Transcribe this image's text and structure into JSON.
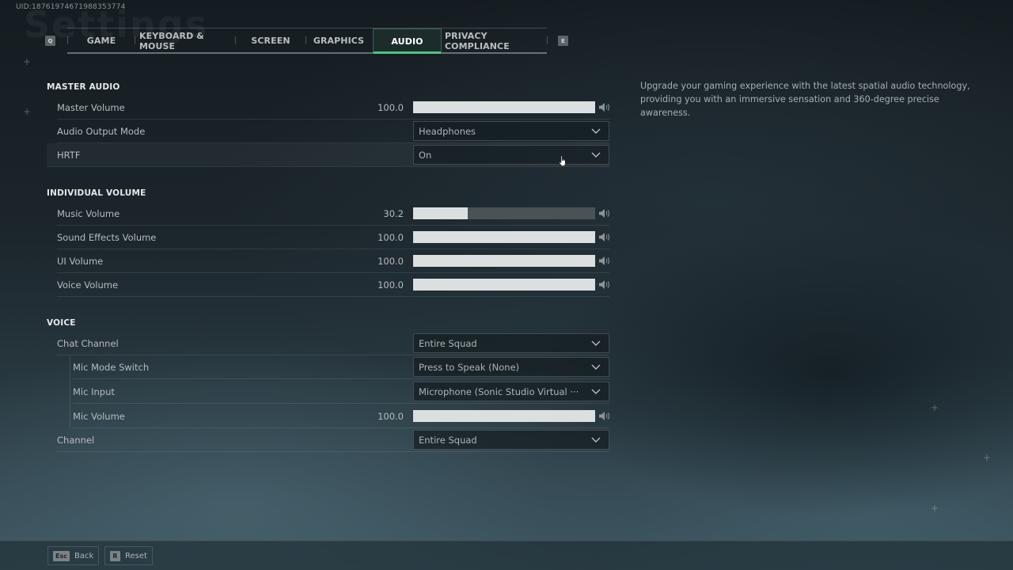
{
  "page": {
    "uid": "UID:18761974671988353774",
    "background_title": "Settings"
  },
  "tabs": {
    "prev_key": "Q",
    "next_key": "E",
    "items": [
      {
        "label": "GAME",
        "active": false
      },
      {
        "label": "KEYBOARD & MOUSE",
        "active": false
      },
      {
        "label": "SCREEN",
        "active": false
      },
      {
        "label": "GRAPHICS",
        "active": false
      },
      {
        "label": "AUDIO",
        "active": true
      },
      {
        "label": "PRIVACY COMPLIANCE",
        "active": false
      }
    ],
    "accent_color": "#4fc27e"
  },
  "sections": {
    "master": {
      "title": "MASTER AUDIO",
      "master_volume": {
        "label": "Master Volume",
        "value": "100.0",
        "percent": 100
      },
      "audio_output_mode": {
        "label": "Audio Output Mode",
        "selected": "Headphones"
      },
      "hrtf": {
        "label": "HRTF",
        "selected": "On"
      }
    },
    "individual": {
      "title": "INDIVIDUAL VOLUME",
      "music_volume": {
        "label": "Music Volume",
        "value": "30.2",
        "percent": 30.2
      },
      "sfx_volume": {
        "label": "Sound Effects Volume",
        "value": "100.0",
        "percent": 100
      },
      "ui_volume": {
        "label": "UI Volume",
        "value": "100.0",
        "percent": 100
      },
      "voice_volume": {
        "label": "Voice Volume",
        "value": "100.0",
        "percent": 100
      }
    },
    "voice": {
      "title": "VOICE",
      "chat_channel": {
        "label": "Chat Channel",
        "selected": "Entire Squad"
      },
      "mic_mode_switch": {
        "label": "Mic Mode Switch",
        "selected": "Press to Speak (None)"
      },
      "mic_input": {
        "label": "Mic Input",
        "selected": "Microphone (Sonic Studio Virtual ···"
      },
      "mic_volume": {
        "label": "Mic Volume",
        "value": "100.0",
        "percent": 100
      },
      "channel": {
        "label": "Channel",
        "selected": "Entire Squad"
      }
    }
  },
  "description": "Upgrade your gaming experience with the latest spatial audio technology, providing you with an immersive sensation and 360-degree precise awareness.",
  "footer": {
    "back": {
      "key": "Esc",
      "label": "Back"
    },
    "reset": {
      "key": "R",
      "label": "Reset"
    }
  }
}
